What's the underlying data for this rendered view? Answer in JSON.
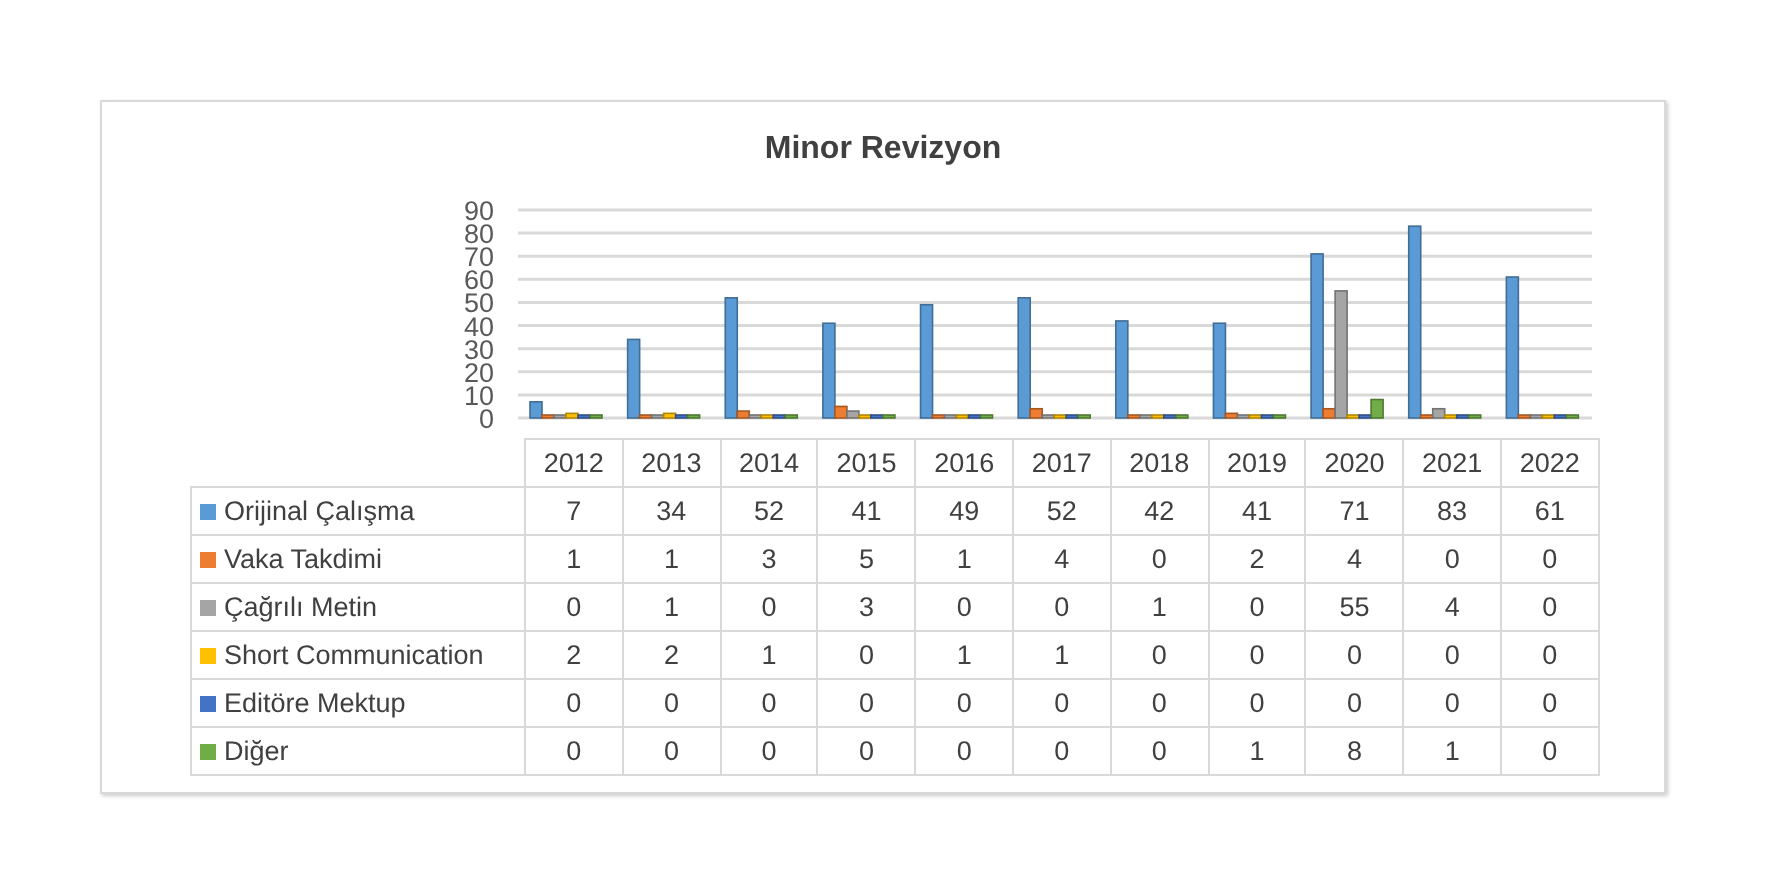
{
  "chart": {
    "chart_data": {
      "type": "bar",
      "title": "Minor Revizyon",
      "categories": [
        "2012",
        "2013",
        "2014",
        "2015",
        "2016",
        "2017",
        "2018",
        "2019",
        "2020",
        "2021",
        "2022"
      ],
      "ylim": [
        0,
        90
      ],
      "yticks": [
        0,
        10,
        20,
        30,
        40,
        50,
        60,
        70,
        80,
        90
      ],
      "legend": true,
      "grid": true,
      "series": [
        {
          "name": "Orijinal Çalışma",
          "color": "#5b9bd5",
          "values": [
            7,
            34,
            52,
            41,
            49,
            52,
            42,
            41,
            71,
            83,
            61
          ]
        },
        {
          "name": "Vaka Takdimi",
          "color": "#ed7d31",
          "values": [
            1,
            1,
            3,
            5,
            1,
            4,
            0,
            2,
            4,
            0,
            0
          ]
        },
        {
          "name": "Çağrılı Metin",
          "color": "#a5a5a5",
          "values": [
            0,
            1,
            0,
            3,
            0,
            0,
            1,
            0,
            55,
            4,
            0
          ]
        },
        {
          "name": "Short Communication",
          "color": "#ffc000",
          "values": [
            2,
            2,
            1,
            0,
            1,
            1,
            0,
            0,
            0,
            0,
            0
          ]
        },
        {
          "name": "Editöre Mektup",
          "color": "#4472c4",
          "values": [
            0,
            0,
            0,
            0,
            0,
            0,
            0,
            0,
            0,
            0,
            0
          ]
        },
        {
          "name": "Diğer",
          "color": "#70ad47",
          "values": [
            0,
            0,
            0,
            0,
            0,
            0,
            0,
            1,
            8,
            1,
            0
          ]
        }
      ]
    },
    "data_table": {
      "rows": [
        [
          "7",
          "34",
          "52",
          "41",
          "49",
          "52",
          "42",
          "41",
          "71",
          "83",
          "61"
        ],
        [
          "1",
          "1",
          "3",
          "5",
          "1",
          "4",
          "0",
          "2",
          "4",
          "0",
          "0"
        ],
        [
          "0",
          "1",
          "0",
          "3",
          "0",
          "0",
          "1",
          "0",
          "55",
          "4",
          "0"
        ],
        [
          "2",
          "2",
          "1",
          "0",
          "1",
          "1",
          "0",
          "0",
          "0",
          "0",
          "0"
        ],
        [
          "0",
          "0",
          "0",
          "0",
          "0",
          "0",
          "0",
          "0",
          "0",
          "0",
          "0"
        ],
        [
          "0",
          "0",
          "0",
          "0",
          "0",
          "0",
          "0",
          "1",
          "8",
          "1",
          "0"
        ]
      ]
    }
  }
}
